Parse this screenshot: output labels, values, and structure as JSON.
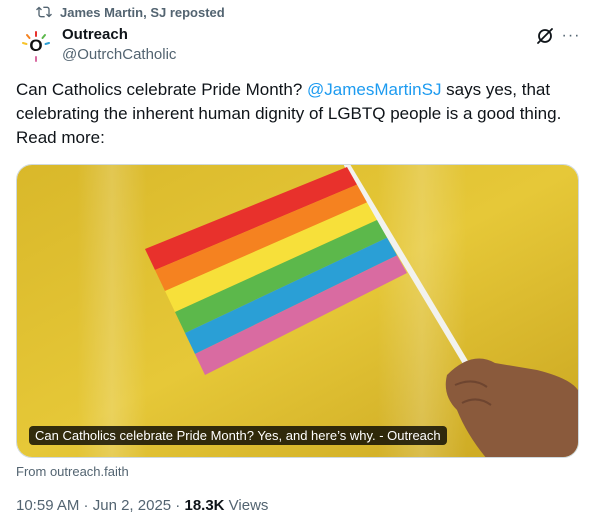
{
  "repost": {
    "label": "James Martin, SJ reposted",
    "icon": "repost-icon"
  },
  "author": {
    "name": "Outreach",
    "handle": "@OutrchCatholic",
    "avatar_letter": "O"
  },
  "tweet": {
    "text_part1": "Can Catholics celebrate Pride Month? ",
    "mention": "@JamesMartinSJ",
    "text_part2": " says yes, that celebrating the inherent human dignity of LGBTQ people is a good thing. Read more:"
  },
  "media": {
    "caption": "Can Catholics celebrate Pride Month? Yes, and here’s why. - Outreach",
    "flag_colors": [
      "#e8312c",
      "#f58220",
      "#f7e03a",
      "#5cb84b",
      "#2a9fd6",
      "#d96ba1"
    ]
  },
  "link": {
    "source": "From outreach.faith"
  },
  "meta": {
    "time": "10:59 AM",
    "sep1": " · ",
    "date": "Jun 2, 2025",
    "sep2": " · ",
    "views_count": "18.3K",
    "views_label": " Views"
  },
  "colors": {
    "accent": "#1d9bf0",
    "secondary": "#536471",
    "text": "#0f1419"
  }
}
